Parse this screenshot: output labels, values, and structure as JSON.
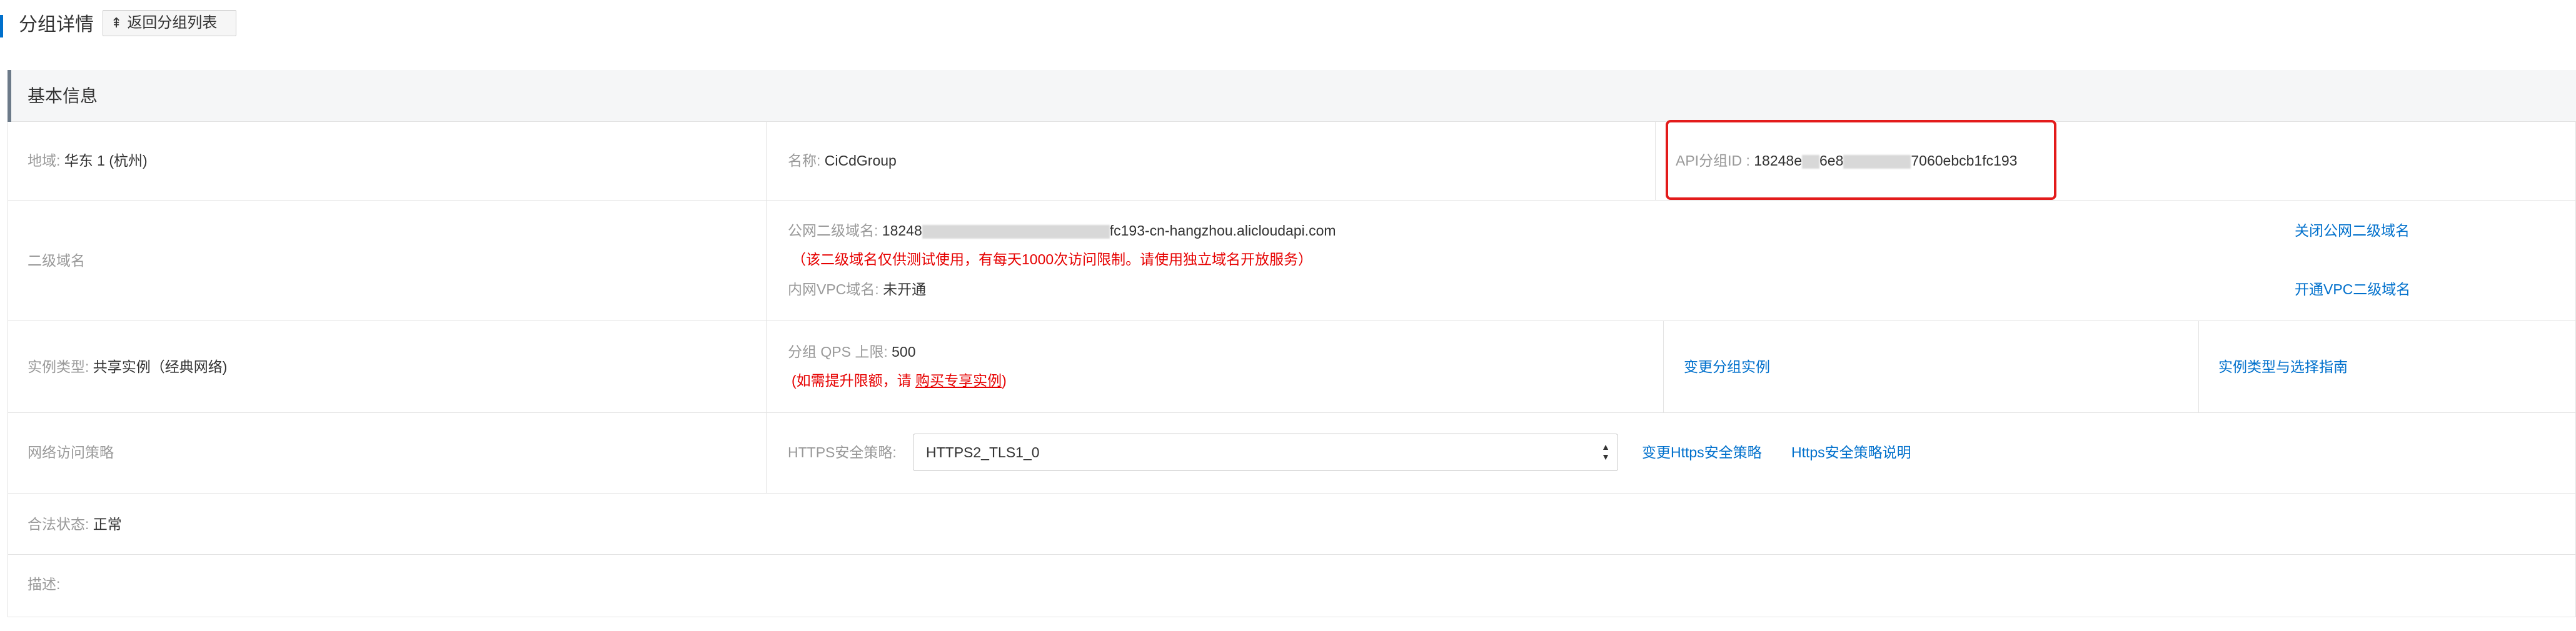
{
  "header": {
    "title": "分组详情",
    "back_button": "返回分组列表",
    "back_icon": "upload-arrow-icon"
  },
  "section": {
    "title": "基本信息"
  },
  "rows": {
    "region": {
      "label": "地域:",
      "value": "华东 1 (杭州)"
    },
    "name": {
      "label": "名称:",
      "value": "CiCdGroup"
    },
    "group_id": {
      "label": "API分组ID :",
      "prefix": "18248e",
      "mid1": "6e8",
      "mid2": "7060",
      "suffix": "ebcb1fc193"
    },
    "subdomain": {
      "label": "二级域名",
      "public_label": "公网二级域名:",
      "public_prefix": "18248",
      "public_suffix": "fc193-cn-hangzhou.alicloudapi.com",
      "public_note": "（该二级域名仅供测试使用，有每天1000次访问限制。请使用独立域名开放服务）",
      "vpc_label": "内网VPC域名:",
      "vpc_value": "未开通",
      "close_public_link": "关闭公网二级域名",
      "open_vpc_link": "开通VPC二级域名"
    },
    "instance": {
      "label": "实例类型:",
      "value": "共享实例（经典网络)",
      "qps_label": "分组 QPS 上限:",
      "qps_value": "500",
      "note_prefix": "(如需提升限额，请 ",
      "note_link": "购买专享实例",
      "note_suffix": ")",
      "change_link": "变更分组实例",
      "guide_link": "实例类型与选择指南"
    },
    "network": {
      "label": "网络访问策略",
      "https_label": "HTTPS安全策略:",
      "https_value": "HTTPS2_TLS1_0",
      "change_link": "变更Https安全策略",
      "doc_link": "Https安全策略说明"
    },
    "legal": {
      "label": "合法状态:",
      "value": "正常"
    },
    "desc": {
      "label": "描述:"
    }
  },
  "colors": {
    "link": "#0070cc",
    "warning": "#e60000",
    "highlight_box": "#e31b1b"
  }
}
